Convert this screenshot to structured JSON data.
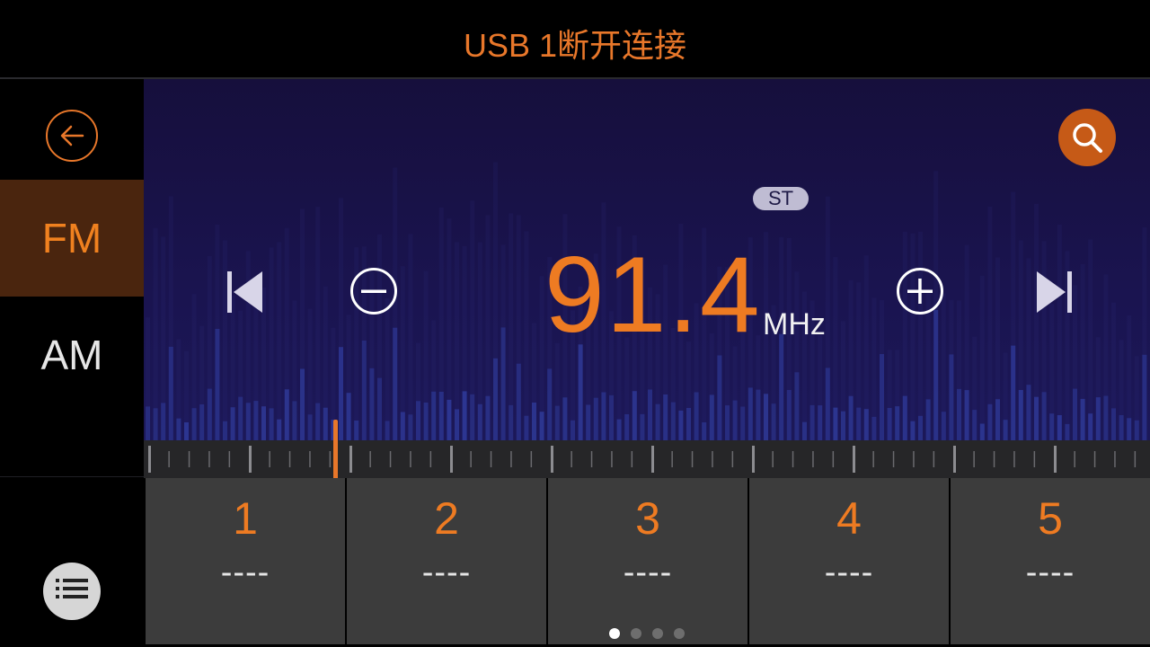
{
  "header": {
    "title": "USB 1断开连接"
  },
  "sidebar": {
    "bands": [
      {
        "label": "FM",
        "active": true
      },
      {
        "label": "AM",
        "active": false
      }
    ]
  },
  "tuner": {
    "stereo_badge": "ST",
    "frequency": "91.4",
    "unit": "MHz",
    "dial_position_mhz": 91.4
  },
  "presets": [
    {
      "number": "1",
      "name": "----"
    },
    {
      "number": "2",
      "name": "----"
    },
    {
      "number": "3",
      "name": "----"
    },
    {
      "number": "4",
      "name": "----"
    },
    {
      "number": "5",
      "name": "----"
    }
  ],
  "pager": {
    "pages": 4,
    "current": 1
  },
  "colors": {
    "accent": "#ee7b22",
    "active_band_bg": "#4a250e",
    "panel_bg": "#1a1450",
    "preset_bg": "#3c3c3c"
  },
  "icons": [
    "back-arrow-icon",
    "search-icon",
    "previous-station-icon",
    "tune-down-icon",
    "tune-up-icon",
    "next-station-icon",
    "list-icon"
  ]
}
